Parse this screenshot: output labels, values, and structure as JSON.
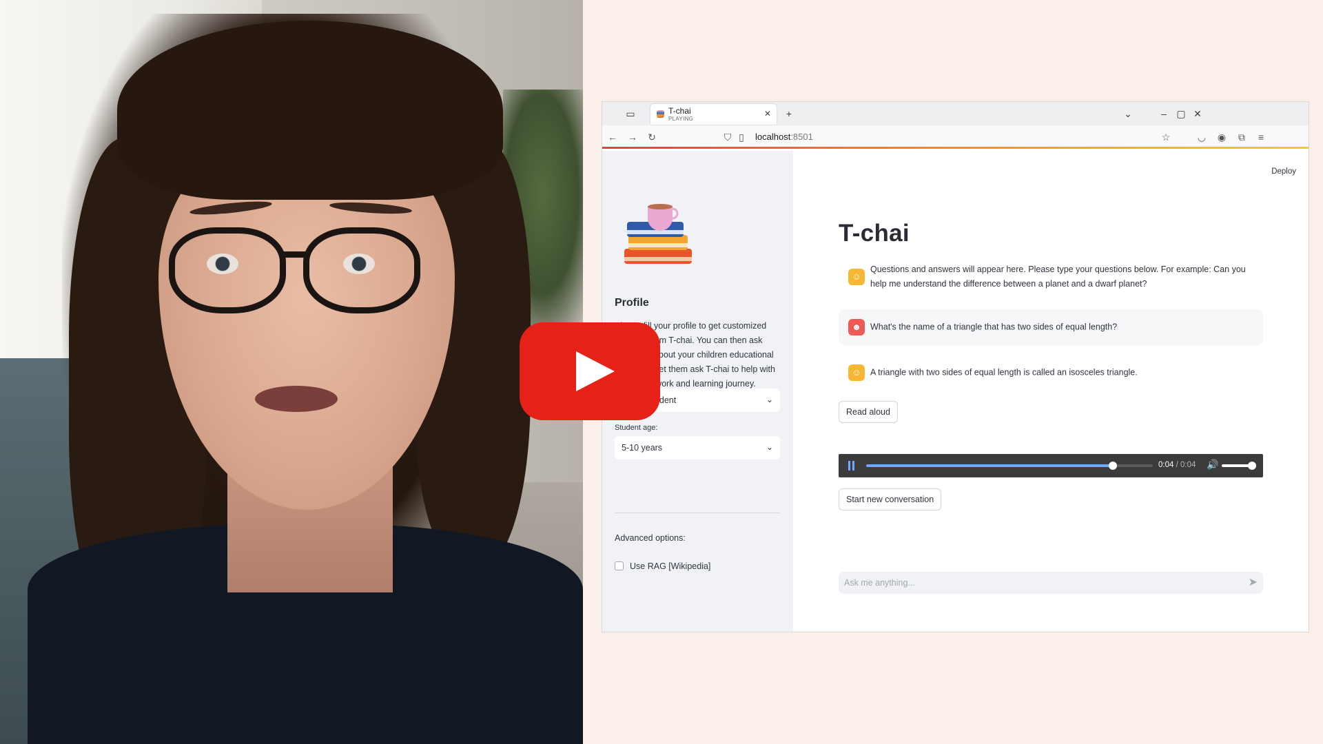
{
  "overlay": {
    "play_icon": "youtube-play-icon",
    "brand_color": "#e62117"
  },
  "browser": {
    "tab": {
      "title": "T-chai",
      "status": "PLAYING",
      "close_icon": "close-icon"
    },
    "new_tab_icon": "plus-icon",
    "url_host": "localhost",
    "url_port": ":8501"
  },
  "sidebar": {
    "profile_heading": "Profile",
    "profile_description": "Please fill your profile to get customized answers from T-chai. You can then ask questions about your children educational journey, or let them ask T-chai to help with their homework and learning journey.",
    "role_select": {
      "value": "I am a student"
    },
    "age_label": "Student age:",
    "age_select": {
      "value": "5-10 years"
    },
    "advanced_label": "Advanced options:",
    "rag_checkbox": {
      "label": "Use RAG [Wikipedia]",
      "checked": false
    }
  },
  "main": {
    "deploy_label": "Deploy",
    "title": "T-chai",
    "messages": [
      {
        "role": "assistant",
        "text": "Questions and answers will appear here. Please type your questions below. For example: Can you help me understand the difference between a planet and a dwarf planet?"
      },
      {
        "role": "user",
        "text": "What's the name of a triangle that has two sides of equal length?"
      },
      {
        "role": "assistant",
        "text": "A triangle with two sides of equal length is called an isosceles triangle."
      }
    ],
    "read_aloud_label": "Read aloud",
    "audio": {
      "current_time": "0:04",
      "separator": " / ",
      "total_time": "0:04",
      "progress": 0.86,
      "volume": 1.0
    },
    "new_conversation_label": "Start new conversation",
    "chat_placeholder": "Ask me anything..."
  },
  "colors": {
    "sidebar_bg": "#f0f2f6",
    "assistant_avatar": "#f7b733",
    "user_avatar": "#ef5a54",
    "user_msg_bg": "#f6f7f9",
    "page_bg": "#fbefe9"
  }
}
